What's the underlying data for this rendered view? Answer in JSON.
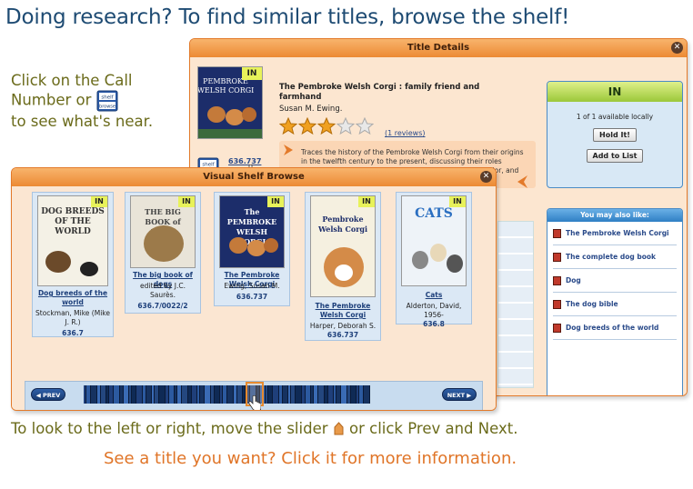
{
  "heading": "Doing research? To find similar titles, browse the shelf!",
  "side_note": {
    "line1": "Click on the Call",
    "line2_before": "Number or",
    "line3": "to see what's near."
  },
  "shelf_button_label": "shelf browse",
  "bottom_instructions": {
    "line1_before": "To look to the left or right, move the slider",
    "line1_after": "or click Prev and Next.",
    "line2": "See a title you want? Click it for more information."
  },
  "title_details": {
    "window_title": "Title Details",
    "status_badge": "IN",
    "title": "The Pembroke Welsh Corgi : family friend and farmhand",
    "author": "Susan M. Ewing.",
    "rating": 3,
    "rating_max": 5,
    "reviews_link": "1 reviews",
    "description": "Traces the history of the Pembroke Welsh Corgi from their origins in the twelfth century to the present, discussing their roles throughout history, their physical characteristics, behavior, and needs, and the reasons they make good pets.",
    "call_number": "636.737",
    "availability": {
      "status": "IN",
      "summary": "1 of 1 available locally",
      "hold_button": "Hold It!",
      "list_button": "Add to List"
    },
    "also_like": {
      "header": "You may also like:",
      "items": [
        "The Pembroke Welsh Corgi",
        "The complete dog book",
        "Dog",
        "The dog bible",
        "Dog breeds of the world"
      ]
    }
  },
  "shelf_browse": {
    "window_title": "Visual Shelf Browse",
    "prev_label": "PREV",
    "next_label": "NEXT",
    "books": [
      {
        "badge": "IN",
        "cover_text": "DOG BREEDS OF THE WORLD",
        "title": "Dog breeds of the world",
        "author": "Stockman, Mike (Mike J. R.)",
        "call_number": "636.7"
      },
      {
        "badge": "IN",
        "cover_text": "THE BIG BOOK of DOGS",
        "title": "The big book of dogs",
        "author": "edited by J.C. Saurès.",
        "call_number": "636.7/0022/2"
      },
      {
        "badge": "IN",
        "cover_text": "The PEMBROKE WELSH CORGI",
        "title": "The Pembroke Welsh Corgi",
        "author": "Ewing, Susan M.",
        "call_number": "636.737"
      },
      {
        "badge": "IN",
        "cover_text": "Pembroke Welsh Corgi",
        "title": "The Pembroke Welsh Corgi",
        "author": "Harper, Deborah S.",
        "call_number": "636.737"
      },
      {
        "badge": "IN",
        "cover_text": "CATS",
        "title": "Cats",
        "author": "Alderton, David, 1956-",
        "call_number": "636.8"
      }
    ]
  },
  "colors": {
    "heading": "#1e4b73",
    "olive_text": "#6b6b1b",
    "orange_text": "#e07528",
    "window_border": "#e37a2a"
  }
}
